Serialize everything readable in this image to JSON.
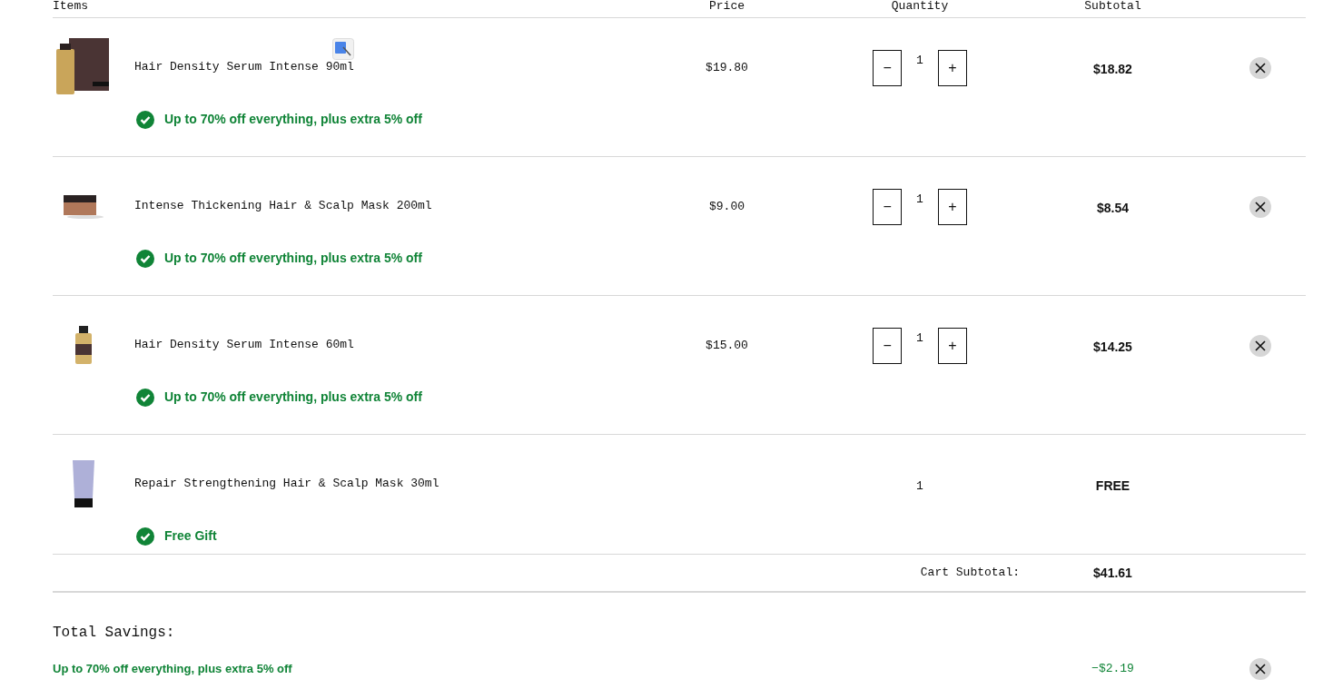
{
  "columns": [
    "Items",
    "Price",
    "Quantity",
    "Subtotal"
  ],
  "items": [
    {
      "kind": "adjustable",
      "name": "Hair Density Serum Intense 90ml",
      "promo": "Up to 70% off everything, plus extra 5% off",
      "price": "$19.80",
      "quantity": "1",
      "minus": "−",
      "plus": "+",
      "subtotal": "$18.82"
    },
    {
      "kind": "adjustable",
      "name": "Intense Thickening Hair & Scalp Mask 200ml",
      "promo": "Up to 70% off everything, plus extra 5% off",
      "price": "$9.00",
      "quantity": "1",
      "minus": "−",
      "plus": "+",
      "subtotal": "$8.54"
    },
    {
      "kind": "adjustable",
      "name": "Hair Density Serum Intense 60ml",
      "promo": "Up to 70% off everything, plus extra 5% off",
      "price": "$15.00",
      "quantity": "1",
      "minus": "−",
      "plus": "+",
      "subtotal": "$14.25"
    },
    {
      "kind": "gift",
      "name": "Repair Strengthening Hair & Scalp Mask 30ml",
      "promo": "Free Gift",
      "quantity": "1",
      "subtotal": "FREE"
    }
  ],
  "cart_subtotal": {
    "label": "Cart Subtotal:",
    "value": "$41.61"
  },
  "savings": {
    "title": "Total Savings:",
    "items": [
      {
        "label": "Up to 70% off everything, plus extra 5% off",
        "value": "−$2.19"
      }
    ]
  }
}
